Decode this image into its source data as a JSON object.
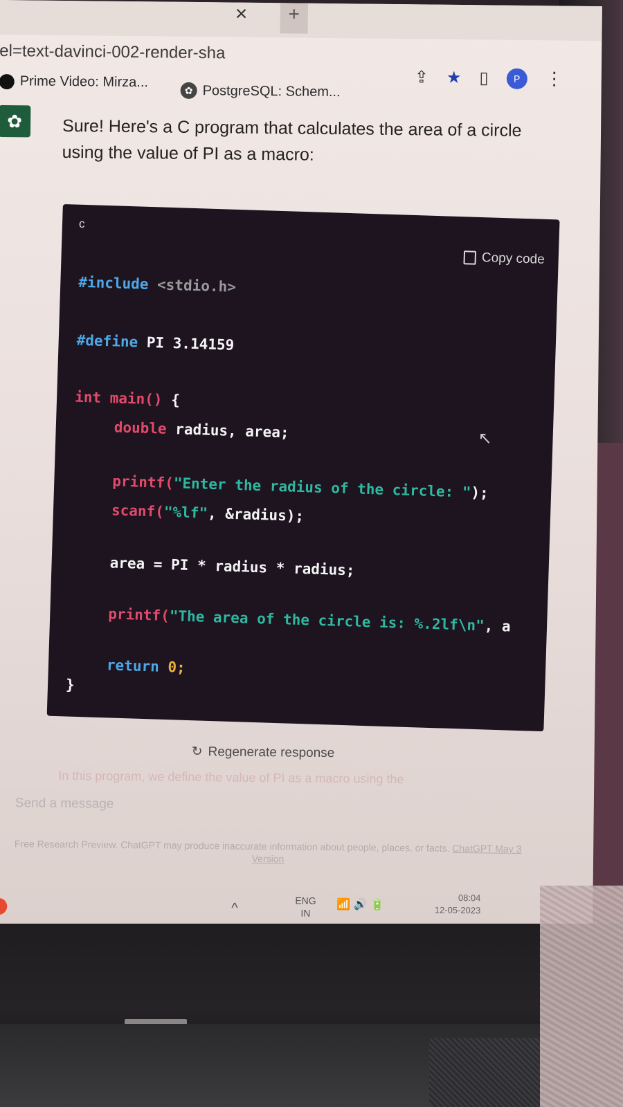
{
  "browser": {
    "tab_close_glyph": "×",
    "new_tab_glyph": "+",
    "url_fragment": "el=text-davinci-002-render-sha",
    "toolbar": {
      "share_icon": "share-icon",
      "star_icon": "star-icon",
      "sidebar_icon": "sidebar-icon",
      "avatar_letter": "P",
      "menu_icon": "more-vert-icon"
    },
    "bookmarks": [
      {
        "label": "Prime Video: Mirza..."
      },
      {
        "label": "PostgreSQL: Schem..."
      }
    ]
  },
  "chat": {
    "intro_text": "Sure! Here's a C program that calculates the area of a circle using the value of PI as a macro:",
    "code_block": {
      "language": "c",
      "copy_label": "Copy code",
      "lines": {
        "l1_kw": "#include",
        "l1_rest": " <stdio.h>",
        "l2_kw": "#define",
        "l2_rest": " PI 3.14159",
        "l3_kw": "int main()",
        "l3_rest": " {",
        "l4_kw": "double",
        "l4_rest": " radius, area;",
        "l5_fn": "printf(",
        "l5_str": "\"Enter the radius of the circle: \"",
        "l5_end": ");",
        "l6_fn": "scanf(",
        "l6_str": "\"%lf\"",
        "l6_end": ", &radius);",
        "l7": "area = PI * radius * radius;",
        "l8_fn": "printf(",
        "l8_str": "\"The area of the circle is: %.2lf\\n\"",
        "l8_end": ", a",
        "l9_kw": "return",
        "l9_rest": " 0;",
        "l10": "}"
      }
    },
    "regenerate_label": "Regenerate response",
    "faded_continuation": "In this program, we define the value of PI as a macro using the",
    "input_placeholder": "Send a message",
    "footer_text": "Free Research Preview. ChatGPT may produce inaccurate information about people, places, or facts.",
    "footer_link": "ChatGPT May 3 Version"
  },
  "taskbar": {
    "lang_line1": "ENG",
    "lang_line2": "IN",
    "time": "08:04",
    "date": "12-05-2023"
  }
}
